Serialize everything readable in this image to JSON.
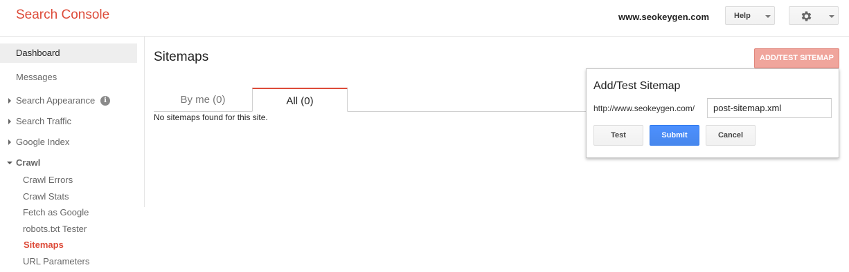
{
  "header": {
    "brand": "Search Console",
    "site": "www.seokeygen.com",
    "help_label": "Help",
    "settings_icon": "gear-icon"
  },
  "sidebar": {
    "dashboard": "Dashboard",
    "messages": "Messages",
    "search_appearance": "Search Appearance",
    "search_traffic": "Search Traffic",
    "google_index": "Google Index",
    "crawl": "Crawl",
    "crawl_items": [
      "Crawl Errors",
      "Crawl Stats",
      "Fetch as Google",
      "robots.txt Tester",
      "Sitemaps",
      "URL Parameters"
    ]
  },
  "main": {
    "title": "Sitemaps",
    "add_test_button": "ADD/TEST SITEMAP",
    "tabs": [
      {
        "label": "By me (0)"
      },
      {
        "label": "All (0)"
      }
    ],
    "empty_message": "No sitemaps found for this site."
  },
  "popup": {
    "title": "Add/Test Sitemap",
    "url_prefix": "http://www.seokeygen.com/",
    "input_value": "post-sitemap.xml",
    "test_label": "Test",
    "submit_label": "Submit",
    "cancel_label": "Cancel"
  },
  "colors": {
    "brand_red": "#dd4b39",
    "submit_blue": "#4d90fe",
    "add_test_pink": "#f0a59c"
  }
}
